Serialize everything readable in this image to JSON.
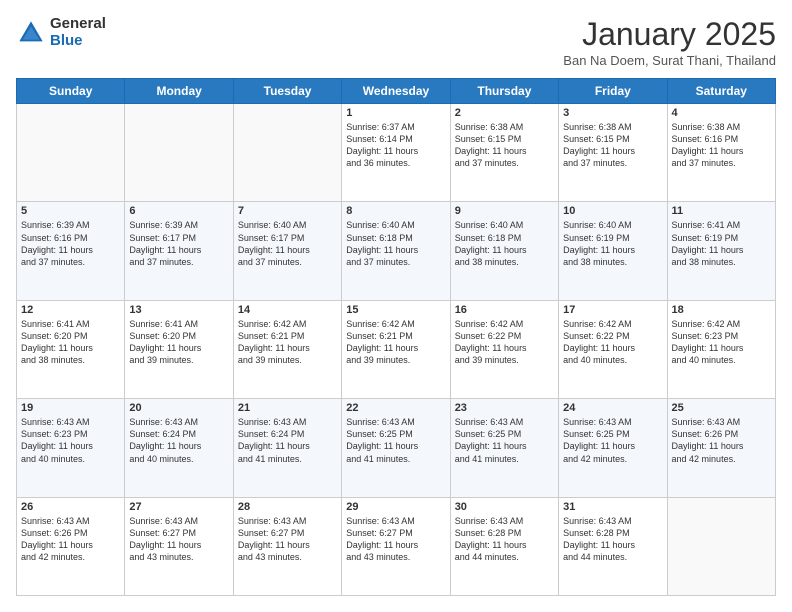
{
  "header": {
    "logo_general": "General",
    "logo_blue": "Blue",
    "month_title": "January 2025",
    "location": "Ban Na Doem, Surat Thani, Thailand"
  },
  "weekdays": [
    "Sunday",
    "Monday",
    "Tuesday",
    "Wednesday",
    "Thursday",
    "Friday",
    "Saturday"
  ],
  "weeks": [
    [
      {
        "day": "",
        "info": ""
      },
      {
        "day": "",
        "info": ""
      },
      {
        "day": "",
        "info": ""
      },
      {
        "day": "1",
        "info": "Sunrise: 6:37 AM\nSunset: 6:14 PM\nDaylight: 11 hours\nand 36 minutes."
      },
      {
        "day": "2",
        "info": "Sunrise: 6:38 AM\nSunset: 6:15 PM\nDaylight: 11 hours\nand 37 minutes."
      },
      {
        "day": "3",
        "info": "Sunrise: 6:38 AM\nSunset: 6:15 PM\nDaylight: 11 hours\nand 37 minutes."
      },
      {
        "day": "4",
        "info": "Sunrise: 6:38 AM\nSunset: 6:16 PM\nDaylight: 11 hours\nand 37 minutes."
      }
    ],
    [
      {
        "day": "5",
        "info": "Sunrise: 6:39 AM\nSunset: 6:16 PM\nDaylight: 11 hours\nand 37 minutes."
      },
      {
        "day": "6",
        "info": "Sunrise: 6:39 AM\nSunset: 6:17 PM\nDaylight: 11 hours\nand 37 minutes."
      },
      {
        "day": "7",
        "info": "Sunrise: 6:40 AM\nSunset: 6:17 PM\nDaylight: 11 hours\nand 37 minutes."
      },
      {
        "day": "8",
        "info": "Sunrise: 6:40 AM\nSunset: 6:18 PM\nDaylight: 11 hours\nand 37 minutes."
      },
      {
        "day": "9",
        "info": "Sunrise: 6:40 AM\nSunset: 6:18 PM\nDaylight: 11 hours\nand 38 minutes."
      },
      {
        "day": "10",
        "info": "Sunrise: 6:40 AM\nSunset: 6:19 PM\nDaylight: 11 hours\nand 38 minutes."
      },
      {
        "day": "11",
        "info": "Sunrise: 6:41 AM\nSunset: 6:19 PM\nDaylight: 11 hours\nand 38 minutes."
      }
    ],
    [
      {
        "day": "12",
        "info": "Sunrise: 6:41 AM\nSunset: 6:20 PM\nDaylight: 11 hours\nand 38 minutes."
      },
      {
        "day": "13",
        "info": "Sunrise: 6:41 AM\nSunset: 6:20 PM\nDaylight: 11 hours\nand 39 minutes."
      },
      {
        "day": "14",
        "info": "Sunrise: 6:42 AM\nSunset: 6:21 PM\nDaylight: 11 hours\nand 39 minutes."
      },
      {
        "day": "15",
        "info": "Sunrise: 6:42 AM\nSunset: 6:21 PM\nDaylight: 11 hours\nand 39 minutes."
      },
      {
        "day": "16",
        "info": "Sunrise: 6:42 AM\nSunset: 6:22 PM\nDaylight: 11 hours\nand 39 minutes."
      },
      {
        "day": "17",
        "info": "Sunrise: 6:42 AM\nSunset: 6:22 PM\nDaylight: 11 hours\nand 40 minutes."
      },
      {
        "day": "18",
        "info": "Sunrise: 6:42 AM\nSunset: 6:23 PM\nDaylight: 11 hours\nand 40 minutes."
      }
    ],
    [
      {
        "day": "19",
        "info": "Sunrise: 6:43 AM\nSunset: 6:23 PM\nDaylight: 11 hours\nand 40 minutes."
      },
      {
        "day": "20",
        "info": "Sunrise: 6:43 AM\nSunset: 6:24 PM\nDaylight: 11 hours\nand 40 minutes."
      },
      {
        "day": "21",
        "info": "Sunrise: 6:43 AM\nSunset: 6:24 PM\nDaylight: 11 hours\nand 41 minutes."
      },
      {
        "day": "22",
        "info": "Sunrise: 6:43 AM\nSunset: 6:25 PM\nDaylight: 11 hours\nand 41 minutes."
      },
      {
        "day": "23",
        "info": "Sunrise: 6:43 AM\nSunset: 6:25 PM\nDaylight: 11 hours\nand 41 minutes."
      },
      {
        "day": "24",
        "info": "Sunrise: 6:43 AM\nSunset: 6:25 PM\nDaylight: 11 hours\nand 42 minutes."
      },
      {
        "day": "25",
        "info": "Sunrise: 6:43 AM\nSunset: 6:26 PM\nDaylight: 11 hours\nand 42 minutes."
      }
    ],
    [
      {
        "day": "26",
        "info": "Sunrise: 6:43 AM\nSunset: 6:26 PM\nDaylight: 11 hours\nand 42 minutes."
      },
      {
        "day": "27",
        "info": "Sunrise: 6:43 AM\nSunset: 6:27 PM\nDaylight: 11 hours\nand 43 minutes."
      },
      {
        "day": "28",
        "info": "Sunrise: 6:43 AM\nSunset: 6:27 PM\nDaylight: 11 hours\nand 43 minutes."
      },
      {
        "day": "29",
        "info": "Sunrise: 6:43 AM\nSunset: 6:27 PM\nDaylight: 11 hours\nand 43 minutes."
      },
      {
        "day": "30",
        "info": "Sunrise: 6:43 AM\nSunset: 6:28 PM\nDaylight: 11 hours\nand 44 minutes."
      },
      {
        "day": "31",
        "info": "Sunrise: 6:43 AM\nSunset: 6:28 PM\nDaylight: 11 hours\nand 44 minutes."
      },
      {
        "day": "",
        "info": ""
      }
    ]
  ]
}
